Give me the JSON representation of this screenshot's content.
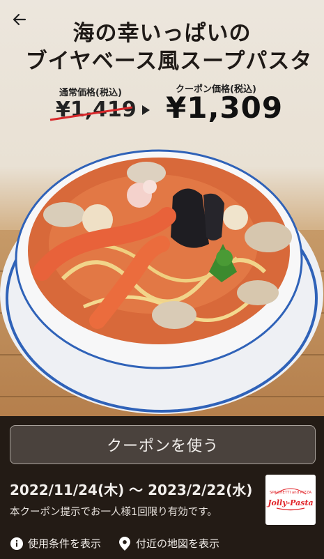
{
  "header": {
    "back_icon": "arrow-left-icon",
    "title_line1": "海の幸いっぱいの",
    "title_line2": "ブイヤベース風スープパスタ"
  },
  "pricing": {
    "regular_label": "通常価格(税込)",
    "regular_price": "¥1,419",
    "coupon_label": "クーポン価格(税込)",
    "coupon_price": "¥1,309"
  },
  "coupon": {
    "use_button": "クーポンを使う",
    "period": "2022/11/24(木) 〜 2023/2/22(水)",
    "note": "本クーポン提示でお一人様1回限り有効です。"
  },
  "brand": {
    "logo_top": "SPAGHETTI and PIZZA",
    "logo_name": "Jolly-Pasta"
  },
  "links": {
    "terms": "使用条件を表示",
    "map": "付近の地図を表示"
  },
  "colors": {
    "panel_bg": "#231b15",
    "button_bg": "#4a423d",
    "strike_red": "#d8282b",
    "logo_red": "#e1252a"
  }
}
